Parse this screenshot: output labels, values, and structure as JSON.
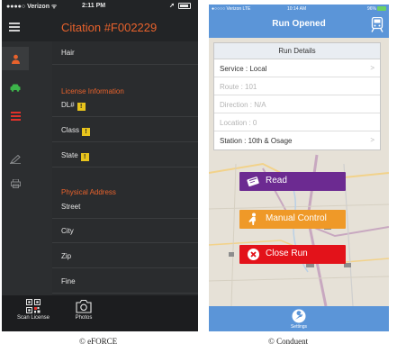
{
  "left_app": {
    "status": {
      "carrier": "●●●●○ Verizon ᯤ",
      "time": "2:11 PM"
    },
    "title": "Citation #F002229",
    "fields_top": [
      {
        "label": "Hair"
      }
    ],
    "license_section": {
      "heading": "License Information",
      "fields": [
        {
          "label": "DL#"
        },
        {
          "label": "Class"
        },
        {
          "label": "State"
        }
      ],
      "warning_glyph": "!"
    },
    "address_section": {
      "heading": "Physical Address",
      "fields": [
        {
          "label": "Street"
        },
        {
          "label": "City"
        },
        {
          "label": "Zip"
        },
        {
          "label": "Fine"
        }
      ]
    },
    "bottom_tabs": [
      {
        "label": "Scan License",
        "icon": "qr-code-icon"
      },
      {
        "label": "Photos",
        "icon": "camera-icon"
      }
    ],
    "sidebar_icons": [
      "person-icon",
      "car-icon",
      "list-icon",
      "signature-icon",
      "printer-icon"
    ],
    "accent_color": "#e8622c"
  },
  "right_app": {
    "status": {
      "carrier": "●○○○○ Verizon LTE",
      "time": "10:14 AM",
      "battery": "96%"
    },
    "title": "Run Opened",
    "panel": {
      "heading": "Run Details",
      "rows": [
        {
          "text": "Service : Local",
          "chevron": ">"
        },
        {
          "text": "Route : 101"
        },
        {
          "text": "Direction : N/A"
        },
        {
          "text": "Location : 0"
        },
        {
          "text": "Station : 10th & Osage",
          "chevron": ">"
        }
      ]
    },
    "buttons": {
      "read": "Read",
      "manual": "Manual Control",
      "close": "Close Run"
    },
    "bottom_tab": {
      "label": "Settings",
      "icon": "wrench-icon"
    },
    "colors": {
      "header": "#5b95d8",
      "read": "#6c2a91",
      "manual": "#ef9928",
      "close": "#e3121a"
    }
  },
  "captions": {
    "left": "© eFORCE",
    "right": "© Conduent"
  }
}
